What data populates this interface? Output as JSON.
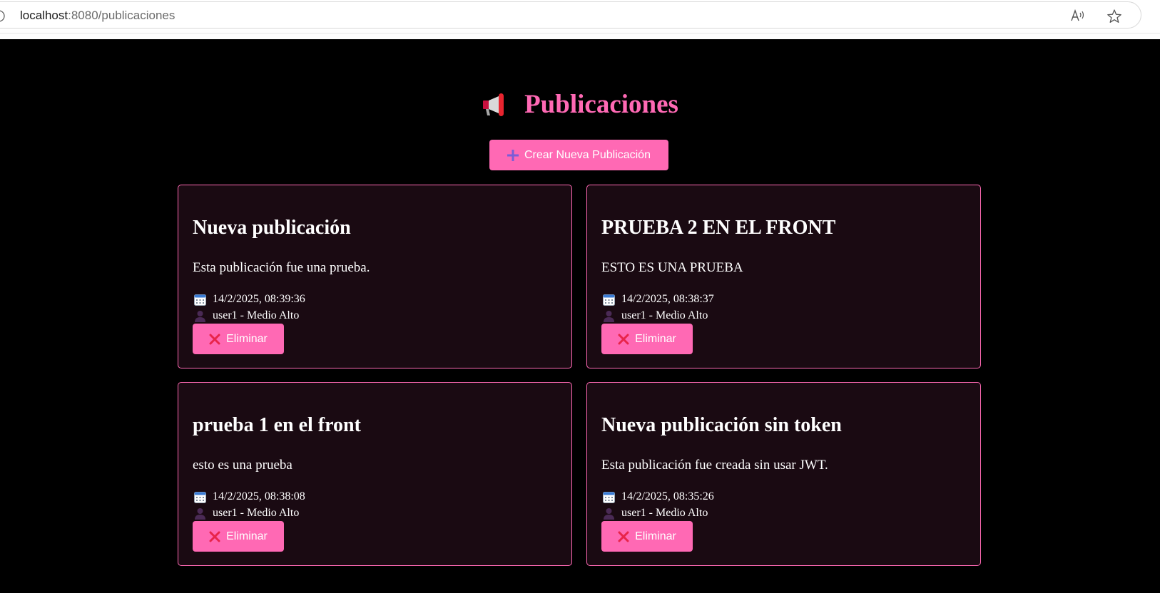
{
  "browser": {
    "url_host": "localhost",
    "url_path": ":8080/publicaciones",
    "icons": [
      "info-icon",
      "read-aloud-icon",
      "favorite-star-icon"
    ]
  },
  "page": {
    "title": "Publicaciones",
    "title_icon": "megaphone-icon",
    "create_button_label": "Crear Nueva Publicación",
    "create_button_icon": "plus-icon"
  },
  "posts": [
    {
      "title": "Nueva publicación",
      "text": "Esta publicación fue una prueba.",
      "date": "14/2/2025, 08:39:36",
      "author": "user1 - Medio Alto",
      "delete_label": "Eliminar"
    },
    {
      "title": "PRUEBA 2 EN EL FRONT",
      "text": "ESTO ES UNA PRUEBA",
      "date": "14/2/2025, 08:38:37",
      "author": "user1 - Medio Alto",
      "delete_label": "Eliminar"
    },
    {
      "title": "prueba 1 en el front",
      "text": "esto es una prueba",
      "date": "14/2/2025, 08:38:08",
      "author": "user1 - Medio Alto",
      "delete_label": "Eliminar"
    },
    {
      "title": "Nueva publicación sin token",
      "text": "Esta publicación fue creada sin usar JWT.",
      "date": "14/2/2025, 08:35:26",
      "author": "user1 - Medio Alto",
      "delete_label": "Eliminar"
    }
  ],
  "colors": {
    "accent": "#ff69b4",
    "card_background": "#1a0a12",
    "page_background": "#000000",
    "text": "#ffffff"
  }
}
